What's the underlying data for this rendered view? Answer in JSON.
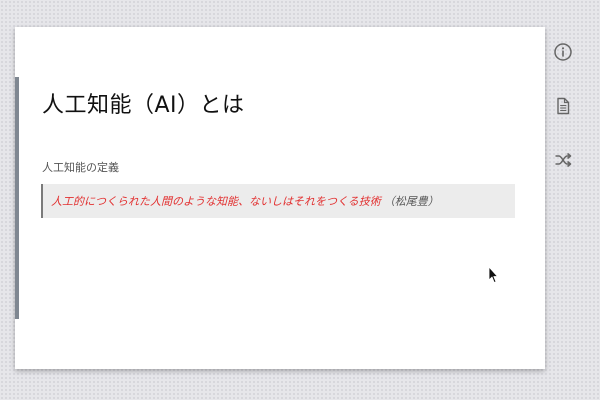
{
  "slide": {
    "title": "人工知能（AI）とは",
    "section_label": "人工知能の定義",
    "quote": {
      "text": "人工的につくられた人間のような知能、ないしはそれをつくる技術",
      "source": "（松尾豊）"
    }
  },
  "colors": {
    "quote_text": "#e23030",
    "accent_bar": "#7f8791",
    "quote_background": "#ececec"
  },
  "toolbar": {
    "items": [
      {
        "icon": "info-icon"
      },
      {
        "icon": "document-icon"
      },
      {
        "icon": "shuffle-icon"
      }
    ]
  }
}
